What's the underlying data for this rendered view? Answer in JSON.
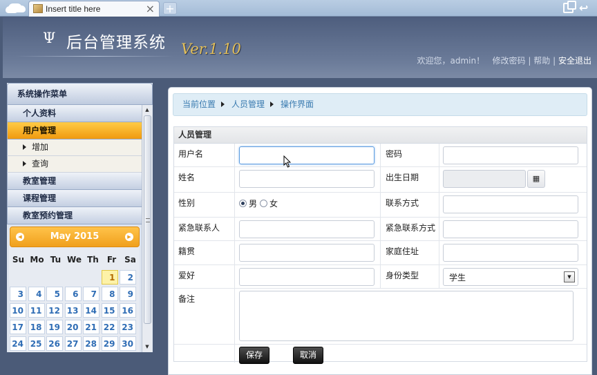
{
  "browser": {
    "tab_title": "Insert title here",
    "tab_close": "×",
    "new_tab": "+",
    "back_glyph": "↩"
  },
  "header": {
    "logo_symbol": "Ψ",
    "title": "后台管理系统",
    "version": "Ver.1.10",
    "welcome": "欢迎您，admin！",
    "change_password": "修改密码",
    "separator": "|",
    "help": "帮助",
    "logout": "安全退出"
  },
  "sidebar": {
    "title": "系统操作菜单",
    "items": [
      {
        "label": "个人资料",
        "type": "item"
      },
      {
        "label": "用户管理",
        "type": "item",
        "active": true
      },
      {
        "label": "增加",
        "type": "sub"
      },
      {
        "label": "查询",
        "type": "sub"
      },
      {
        "label": "教室管理",
        "type": "item"
      },
      {
        "label": "课程管理",
        "type": "item"
      },
      {
        "label": "教室预约管理",
        "type": "item"
      }
    ]
  },
  "calendar": {
    "month_label": "May 2015",
    "weekdays": [
      "Su",
      "Mo",
      "Tu",
      "We",
      "Th",
      "Fr",
      "Sa"
    ],
    "weeks": [
      [
        "",
        "",
        "",
        "",
        "",
        "1",
        "2"
      ],
      [
        "3",
        "4",
        "5",
        "6",
        "7",
        "8",
        "9"
      ],
      [
        "10",
        "11",
        "12",
        "13",
        "14",
        "15",
        "16"
      ],
      [
        "17",
        "18",
        "19",
        "20",
        "21",
        "22",
        "23"
      ],
      [
        "24",
        "25",
        "26",
        "27",
        "28",
        "29",
        "30"
      ]
    ],
    "today": "1"
  },
  "breadcrumb": {
    "items": [
      "当前位置",
      "人员管理",
      "操作界面"
    ]
  },
  "form": {
    "title": "人员管理",
    "username_label": "用户名",
    "username_value": "",
    "password_label": "密码",
    "password_value": "",
    "name_label": "姓名",
    "name_value": "",
    "birthday_label": "出生日期",
    "birthday_value": "",
    "calendar_glyph": "▦",
    "gender_label": "性别",
    "gender_male": "男",
    "gender_female": "女",
    "gender_selected": "男",
    "contact_label": "联系方式",
    "contact_value": "",
    "emergency_contact_label": "紧急联系人",
    "emergency_contact_value": "",
    "emergency_phone_label": "紧急联系方式",
    "emergency_phone_value": "",
    "native_place_label": "籍贯",
    "native_place_value": "",
    "address_label": "家庭住址",
    "address_value": "",
    "hobby_label": "爱好",
    "hobby_value": "",
    "identity_label": "身份类型",
    "identity_value": "学生",
    "remark_label": "备注",
    "remark_value": "",
    "save_label": "保存",
    "cancel_label": "取消"
  }
}
